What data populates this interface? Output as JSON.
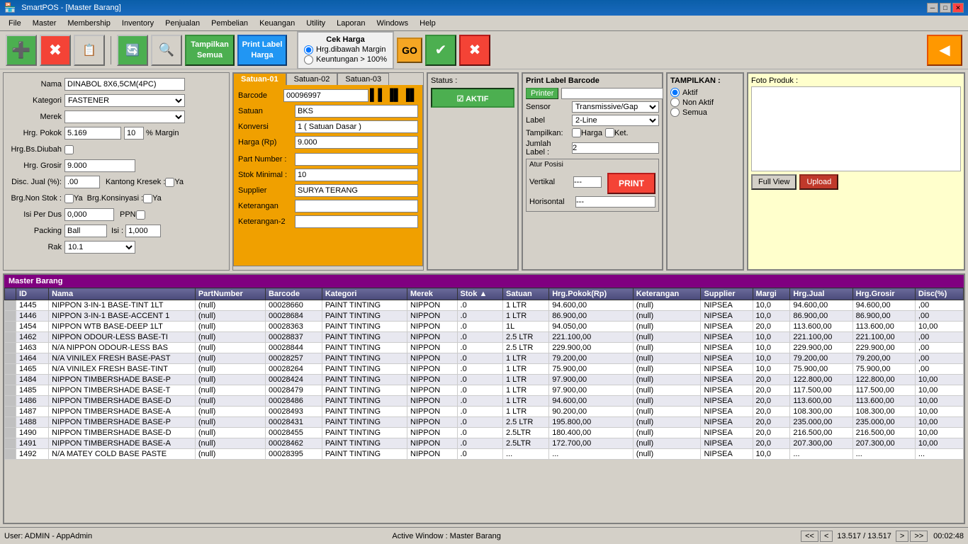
{
  "titlebar": {
    "app": "SmartPOS",
    "window": "[Master Barang]",
    "full": "SmartPOS - [Master Barang]"
  },
  "menubar": {
    "items": [
      "File",
      "Master",
      "Membership",
      "Inventory",
      "Penjualan",
      "Pembelian",
      "Keuangan",
      "Utility",
      "Laporan",
      "Windows",
      "Help"
    ]
  },
  "toolbar": {
    "tampil_semua": "Tampilkan\nSemua",
    "print_label": "Print Label\nHarga",
    "cek_harga_title": "Cek Harga",
    "radio1": "Hrg.dibawah Margin",
    "radio2": "Keuntungan > 100%",
    "go": "GO"
  },
  "form": {
    "nama_label": "Nama",
    "nama_value": "DINABOL 8X6,5CM(4PC)",
    "kategori_label": "Kategori",
    "kategori_value": "FASTENER",
    "merek_label": "Merek",
    "merek_value": "",
    "hrg_pokok_label": "Hrg. Pokok",
    "hrg_pokok_value": "5.169",
    "margin_value": "10",
    "margin_label": "% Margin",
    "hrg_bs_diubah_label": "Hrg.Bs.Diubah",
    "hrg_grosir_label": "Hrg. Grosir",
    "hrg_grosir_value": "9.000",
    "disc_jual_label": "Disc. Jual (%):",
    "disc_jual_value": ".00",
    "kantong_kresek_label": "Kantong Kresek :",
    "kantong_ya": "Ya",
    "brg_non_stok_label": "Brg.Non Stok :",
    "brg_ya": "Ya",
    "brg_konsinyasi_label": "Brg.Konsinyasi :",
    "isi_per_dus_label": "Isi Per Dus",
    "isi_per_dus_value": "0,000",
    "ppn_label": "PPN",
    "packing_label": "Packing",
    "packing_value": "Ball",
    "isi_label": "Isi :",
    "isi_value": "1,000",
    "rak_label": "Rak",
    "rak_value": "10.1"
  },
  "satuan_tabs": [
    "Satuan-01",
    "Satuan-02",
    "Satuan-03"
  ],
  "satuan": {
    "barcode_label": "Barcode",
    "barcode_value": "00096997",
    "satuan_label": "Satuan",
    "satuan_value": "BKS",
    "konversi_label": "Konversi",
    "konversi_value": "1 ( Satuan Dasar )",
    "harga_label": "Harga (Rp)",
    "harga_value": "9.000"
  },
  "more_fields": {
    "part_number_label": "Part Number :",
    "part_number_value": "",
    "stok_minimal_label": "Stok Minimal :",
    "stok_minimal_value": "10",
    "supplier_label": "Supplier",
    "supplier_value": "SURYA TERANG",
    "keterangan_label": "Keterangan",
    "keterangan_value": "",
    "keterangan2_label": "Keterangan-2",
    "keterangan2_value": ""
  },
  "status": {
    "label": "Status :",
    "aktif": "AKTIF"
  },
  "print_label": {
    "title": "Print Label Barcode",
    "printer_label": "Printer",
    "printer_value": "",
    "sensor_label": "Sensor",
    "sensor_value": "Transmissive/Gap",
    "label_label": "Label",
    "label_value": "2-Line",
    "tampilkan_label": "Tampilkan:",
    "harga_label": "Harga",
    "ket_label": "Ket.",
    "jumlah_label": "Jumlah Label :",
    "jumlah_value": "2",
    "atur_posisi": "Atur Posisi",
    "vertikal_label": "Vertikal",
    "vertikal_value": "---",
    "horisontal_label": "Horisontal",
    "horisontal_value": "---",
    "print_btn": "PRINT"
  },
  "tampilkan": {
    "title": "TAMPILKAN :",
    "aktif": "Aktif",
    "non_aktif": "Non Aktif",
    "semua": "Semua"
  },
  "foto": {
    "title": "Foto Produk :",
    "full_view": "Full View",
    "upload": "Upload"
  },
  "table": {
    "title": "Master Barang",
    "headers": [
      "",
      "ID",
      "Nama",
      "PartNumber",
      "Barcode",
      "Kategori",
      "Merek",
      "Stok ▲",
      "Satuan",
      "Hrg.Pokok(Rp)",
      "Keterangan",
      "Supplier",
      "Margi",
      "Hrg.Jual",
      "Hrg.Grosir",
      "Disc(%)"
    ],
    "rows": [
      [
        "",
        "1445",
        "NIPPON 3-IN-1 BASE-TINT 1LT",
        "(null)",
        "00028660",
        "PAINT TINTING",
        "NIPPON",
        ".0",
        "1 LTR",
        "94.600,00",
        "(null)",
        "NIPSEA",
        "10,0",
        "94.600,00",
        "94.600,00",
        ",00"
      ],
      [
        "",
        "1446",
        "NIPPON 3-IN-1 BASE-ACCENT 1",
        "(null)",
        "00028684",
        "PAINT TINTING",
        "NIPPON",
        ".0",
        "1 LTR",
        "86.900,00",
        "(null)",
        "NIPSEA",
        "10,0",
        "86.900,00",
        "86.900,00",
        ",00"
      ],
      [
        "",
        "1454",
        "NIPPON WTB BASE-DEEP 1LT",
        "(null)",
        "00028363",
        "PAINT TINTING",
        "NIPPON",
        ".0",
        "1L",
        "94.050,00",
        "(null)",
        "NIPSEA",
        "20,0",
        "113.600,00",
        "113.600,00",
        "10,00"
      ],
      [
        "",
        "1462",
        "NIPPON ODOUR-LESS BASE-TI",
        "(null)",
        "00028837",
        "PAINT TINTING",
        "NIPPON",
        ".0",
        "2.5 LTR",
        "221.100,00",
        "(null)",
        "NIPSEA",
        "10,0",
        "221.100,00",
        "221.100,00",
        ",00"
      ],
      [
        "",
        "1463",
        "N/A NIPPON ODOUR-LESS BAS",
        "(null)",
        "00028844",
        "PAINT TINTING",
        "NIPPON",
        ".0",
        "2.5 LTR",
        "229.900,00",
        "(null)",
        "NIPSEA",
        "10,0",
        "229.900,00",
        "229.900,00",
        ",00"
      ],
      [
        "",
        "1464",
        "N/A VINILEX FRESH BASE-PAST",
        "(null)",
        "00028257",
        "PAINT TINTING",
        "NIPPON",
        ".0",
        "1 LTR",
        "79.200,00",
        "(null)",
        "NIPSEA",
        "10,0",
        "79.200,00",
        "79.200,00",
        ",00"
      ],
      [
        "",
        "1465",
        "N/A VINILEX FRESH BASE-TINT",
        "(null)",
        "00028264",
        "PAINT TINTING",
        "NIPPON",
        ".0",
        "1 LTR",
        "75.900,00",
        "(null)",
        "NIPSEA",
        "10,0",
        "75.900,00",
        "75.900,00",
        ",00"
      ],
      [
        "",
        "1484",
        "NIPPON TIMBERSHADE BASE-P",
        "(null)",
        "00028424",
        "PAINT TINTING",
        "NIPPON",
        ".0",
        "1 LTR",
        "97.900,00",
        "(null)",
        "NIPSEA",
        "20,0",
        "122.800,00",
        "122.800,00",
        "10,00"
      ],
      [
        "",
        "1485",
        "NIPPON TIMBERSHADE BASE-T",
        "(null)",
        "00028479",
        "PAINT TINTING",
        "NIPPON",
        ".0",
        "1 LTR",
        "97.900,00",
        "(null)",
        "NIPSEA",
        "20,0",
        "117.500,00",
        "117.500,00",
        "10,00"
      ],
      [
        "",
        "1486",
        "NIPPON TIMBERSHADE BASE-D",
        "(null)",
        "00028486",
        "PAINT TINTING",
        "NIPPON",
        ".0",
        "1 LTR",
        "94.600,00",
        "(null)",
        "NIPSEA",
        "20,0",
        "113.600,00",
        "113.600,00",
        "10,00"
      ],
      [
        "",
        "1487",
        "NIPPON TIMBERSHADE BASE-A",
        "(null)",
        "00028493",
        "PAINT TINTING",
        "NIPPON",
        ".0",
        "1 LTR",
        "90.200,00",
        "(null)",
        "NIPSEA",
        "20,0",
        "108.300,00",
        "108.300,00",
        "10,00"
      ],
      [
        "",
        "1488",
        "NIPPON TIMBERSHADE BASE-P",
        "(null)",
        "00028431",
        "PAINT TINTING",
        "NIPPON",
        ".0",
        "2.5 LTR",
        "195.800,00",
        "(null)",
        "NIPSEA",
        "20,0",
        "235.000,00",
        "235.000,00",
        "10,00"
      ],
      [
        "",
        "1490",
        "NIPPON TIMBERSHADE BASE-D",
        "(null)",
        "00028455",
        "PAINT TINTING",
        "NIPPON",
        ".0",
        "2.5LTR",
        "180.400,00",
        "(null)",
        "NIPSEA",
        "20,0",
        "216.500,00",
        "216.500,00",
        "10,00"
      ],
      [
        "",
        "1491",
        "NIPPON TIMBERSHADE BASE-A",
        "(null)",
        "00028462",
        "PAINT TINTING",
        "NIPPON",
        ".0",
        "2.5LTR",
        "172.700,00",
        "(null)",
        "NIPSEA",
        "20,0",
        "207.300,00",
        "207.300,00",
        "10,00"
      ],
      [
        "",
        "1492",
        "N/A MATEY COLD BASE PASTE",
        "(null)",
        "00028395",
        "PAINT TINTING",
        "NIPPON",
        ".0",
        "...",
        "...",
        "(null)",
        "NIPSEA",
        "10,0",
        "...",
        "...",
        "..."
      ]
    ]
  },
  "pagination": {
    "first": "<<",
    "prev": "<",
    "next": ">",
    "last": ">>",
    "info": "13.517 / 13.517"
  },
  "statusbar": {
    "user": "User: ADMIN - AppAdmin",
    "active_window": "Active Window : Master Barang",
    "time": "00:02:48"
  }
}
